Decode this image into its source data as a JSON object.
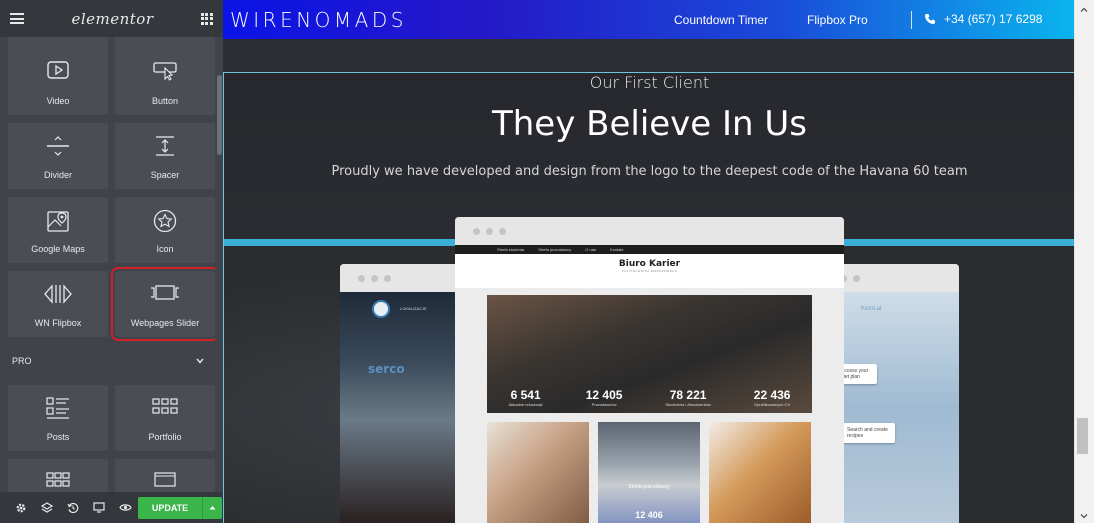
{
  "sidebar": {
    "logo": "elementor",
    "widgets": [
      {
        "label": "Video",
        "icon": "video-icon"
      },
      {
        "label": "Button",
        "icon": "button-pointer-icon"
      },
      {
        "label": "Divider",
        "icon": "divider-icon"
      },
      {
        "label": "Spacer",
        "icon": "spacer-icon"
      },
      {
        "label": "Google Maps",
        "icon": "map-icon"
      },
      {
        "label": "Icon",
        "icon": "star-circle-icon"
      },
      {
        "label": "WN Flipbox",
        "icon": "flipbox-icon"
      },
      {
        "label": "Webpages Slider",
        "icon": "slider-icon"
      }
    ],
    "pro_section": "PRO",
    "pro_widgets": [
      {
        "label": "Posts",
        "icon": "posts-icon"
      },
      {
        "label": "Portfolio",
        "icon": "portfolio-icon"
      }
    ],
    "footer": {
      "update_label": "UPDATE"
    },
    "highlight_color": "#d41f26",
    "update_color": "#39b54a"
  },
  "site": {
    "brand": "WIRENOMADS",
    "nav": [
      "Countdown Timer",
      "Flipbox Pro"
    ],
    "phone": "+34 (657) 17 6298"
  },
  "section": {
    "eyebrow": "Our First Client",
    "headline": "They Believe In Us",
    "subline": "Proudly we have developed and design from the logo to the deepest code of the Havana 60 team"
  },
  "mockup": {
    "nav": [
      "Strefa studenta",
      "Strefa pracodawcy",
      "O nas",
      "Kontakt"
    ],
    "title": "Biuro Karier",
    "subtitle": "POLITECHNIKA WARSZAWSKA",
    "stats": [
      {
        "value": "6 541",
        "label": "Aktualne rekrutacje"
      },
      {
        "value": "12 405",
        "label": "Pracodawców"
      },
      {
        "value": "78 221",
        "label": "Studentów i Absolwentów"
      },
      {
        "value": "22 436",
        "label": "Opublikowanych CV"
      }
    ],
    "tile_label": "Strefa pracodawcy",
    "tile_number": "12 406",
    "left_brand": "serco",
    "left_link": "LOKALIZACJE",
    "right_brand": "KetoLal",
    "card1": "Access your diet plan",
    "card2": "Search and create recipes"
  }
}
